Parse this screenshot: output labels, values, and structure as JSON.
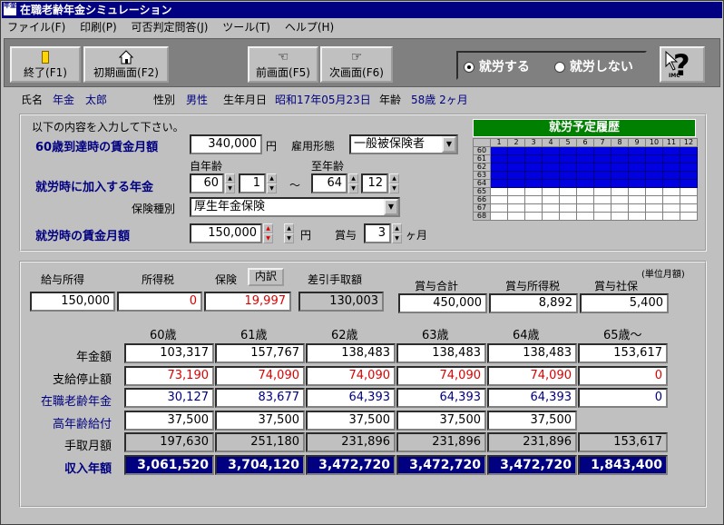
{
  "window": {
    "title": "在職老齢年金シミュレーション",
    "icon_text": "年金"
  },
  "menu": [
    "ファイル(F)",
    "印刷(P)",
    "可否判定問答(J)",
    "ツール(T)",
    "ヘルプ(H)"
  ],
  "toolbar": {
    "end": "終了(F1)",
    "init": "初期画面(F2)",
    "prev": "前画面(F5)",
    "next": "次画面(F6)",
    "work": "就労する",
    "nowork": "就労しない",
    "work_selected": true,
    "help_label": "IMC"
  },
  "person": {
    "name_label": "氏名",
    "name": "年金　太郎",
    "sex_label": "性別",
    "sex": "男性",
    "birth_label": "生年月日",
    "birth": "昭和17年05月23日",
    "age_label": "年齢",
    "age": "58歳 2ヶ月"
  },
  "form": {
    "instruction": "以下の内容を入力して下さい。",
    "wage60_label": "60歳到達時の賃金月額",
    "wage60": "340,000",
    "yen": "円",
    "emp_type_label": "雇用形態",
    "emp_type": "一般被保険者",
    "from_age_label": "自年齢",
    "to_age_label": "至年齢",
    "pension_label": "就労時に加入する年金",
    "from_age": "60",
    "from_month": "1",
    "tilde": "～",
    "to_age": "64",
    "to_month": "12",
    "ins_type_label": "保険種別",
    "ins_type": "厚生年金保険",
    "wage_work_label": "就労時の賃金月額",
    "wage_work": "150,000",
    "yen2": "円",
    "bonus_label": "賞与",
    "bonus": "3",
    "bonus_unit": "ヶ月"
  },
  "history": {
    "title": "就労予定履歴",
    "months": [
      "1",
      "2",
      "3",
      "4",
      "5",
      "6",
      "7",
      "8",
      "9",
      "10",
      "11",
      "12"
    ],
    "ages": [
      "60",
      "61",
      "62",
      "63",
      "64",
      "65",
      "66",
      "67",
      "68"
    ],
    "filled_ages": 5
  },
  "summary": {
    "unit_note": "(単位月額)",
    "headers": {
      "salary": "給与所得",
      "tax": "所得税",
      "ins": "保険",
      "detail_btn": "内訳",
      "net": "差引手取額",
      "bonus_total": "賞与合計",
      "bonus_tax": "賞与所得税",
      "bonus_ins": "賞与社保"
    },
    "values": {
      "salary": "150,000",
      "tax": "0",
      "ins": "19,997",
      "net": "130,003",
      "bonus_total": "450,000",
      "bonus_tax": "8,892",
      "bonus_ins": "5,400"
    }
  },
  "table": {
    "columns": [
      "60歳",
      "61歳",
      "62歳",
      "63歳",
      "64歳",
      "65歳～"
    ],
    "rows": [
      {
        "label": "年金額",
        "style": "white",
        "values": [
          "103,317",
          "157,767",
          "138,483",
          "138,483",
          "138,483",
          "153,617"
        ]
      },
      {
        "label": "支給停止額",
        "style": "red",
        "values": [
          "73,190",
          "74,090",
          "74,090",
          "74,090",
          "74,090",
          "0"
        ]
      },
      {
        "label": "在職老齢年金",
        "style": "blue",
        "values": [
          "30,127",
          "83,677",
          "64,393",
          "64,393",
          "64,393",
          "0"
        ]
      },
      {
        "label": "高年齢給付",
        "style": "bluelabel",
        "values": [
          "37,500",
          "37,500",
          "37,500",
          "37,500",
          "37,500",
          ""
        ]
      },
      {
        "label": "手取月額",
        "style": "gray",
        "values": [
          "197,630",
          "251,180",
          "231,896",
          "231,896",
          "231,896",
          "153,617"
        ]
      },
      {
        "label": "収入年額",
        "style": "navy",
        "values": [
          "3,061,520",
          "3,704,120",
          "3,472,720",
          "3,472,720",
          "3,472,720",
          "1,843,400"
        ]
      }
    ]
  },
  "colors": {
    "navy": "#000080",
    "history_fill": "#0000e0",
    "red": "#e00000"
  }
}
